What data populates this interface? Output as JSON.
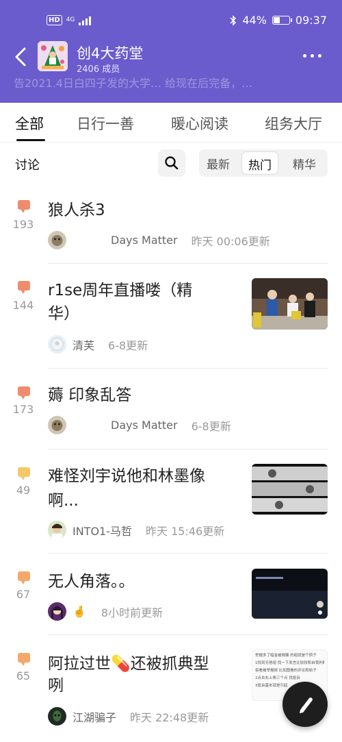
{
  "status_bar": {
    "hd": "HD",
    "network": "4G",
    "battery_percent_text": "44%",
    "battery_level": 0.44,
    "time": "09:37"
  },
  "header": {
    "title": "创4大药堂",
    "members": "2406 成员",
    "announcement": "告2021.4日白四子发的大学…  给现在后完备，…",
    "accent_color": "#6a5ccc"
  },
  "tabs": [
    {
      "label": "全部",
      "active": true
    },
    {
      "label": "日行一善"
    },
    {
      "label": "暖心阅读"
    },
    {
      "label": "组务大厅"
    }
  ],
  "filter": {
    "label": "讨论",
    "sort_options": [
      "最新",
      "热门",
      "精华"
    ],
    "active_sort": "热门"
  },
  "posts": [
    {
      "title_line1": "狼人杀3",
      "title_line2": "",
      "count": "193",
      "author": "Days Matter",
      "time": "昨天 00:06更新",
      "icon_color": "#f08c6e"
    },
    {
      "title_line1": "r1se周年直播喽（精",
      "title_line2": "华）",
      "count": "144",
      "author": "清芙",
      "time": "6-8更新",
      "icon_color": "#f08c6e"
    },
    {
      "title_line1": "薅 印象乱答",
      "title_line2": "",
      "count": "173",
      "author": "Days Matter",
      "time": "6-8更新",
      "icon_color": "#f08c6e"
    },
    {
      "title_line1": "难怪刘宇说他和林墨像",
      "title_line2": "啊...",
      "count": "49",
      "author": "INTO1-马哲",
      "time": "昨天 15:46更新",
      "icon_color": "#f5c86a"
    },
    {
      "title_line1": "无人角落。。",
      "title_line2": "",
      "count": "67",
      "author": "🤞",
      "time": "8小时前更新",
      "icon_color": "#f5a86a"
    },
    {
      "title_line1": "阿拉过世💊还被抓典型",
      "title_line2": "咧",
      "count": "65",
      "author": "江湖骗子",
      "time": "昨天 22:48更新",
      "icon_color": "#f5a86a"
    }
  ],
  "thumb4_captions": [
    "",
    "",
    ""
  ],
  "thumb6_lines": [
    "举报多了暗金被揭揍 的组就是个例子",
    "1找到无他组 找一下发言比较较和自我判断",
    "容看被举报掉 比如图看的评论和帖子",
    "2点击右上角三个点 找投诉",
    "3投诉基本就是引起"
  ]
}
